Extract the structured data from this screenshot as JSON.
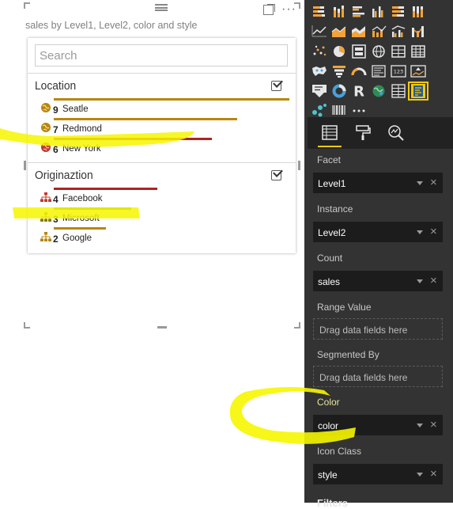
{
  "visual": {
    "title": "sales by Level1, Level2, color and style",
    "more": "···"
  },
  "facet": {
    "search_placeholder": "Search",
    "groups": [
      {
        "title": "Location",
        "items": [
          {
            "count": "9",
            "label": "Seatle",
            "bar_fraction": 1.0,
            "bar_color": "#b8860b",
            "icon": "globe-icon",
            "icon_color": "#b8860b"
          },
          {
            "count": "7",
            "label": "Redmond",
            "bar_fraction": 0.78,
            "bar_color": "#b8860b",
            "icon": "globe-icon",
            "icon_color": "#b8860b"
          },
          {
            "count": "6",
            "label": "New York",
            "bar_fraction": 0.67,
            "bar_color": "#b22222",
            "icon": "globe-icon",
            "icon_color": "#c0392b"
          }
        ]
      },
      {
        "title": "Originaztion",
        "items": [
          {
            "count": "4",
            "label": "Facebook",
            "bar_fraction": 0.44,
            "bar_color": "#b22222",
            "icon": "org-chart-icon",
            "icon_color": "#c0392b"
          },
          {
            "count": "3",
            "label": "Microsoft",
            "bar_fraction": 0.33,
            "bar_color": "#6b8e23",
            "icon": "org-chart-icon",
            "icon_color": "#8a7a10"
          },
          {
            "count": "2",
            "label": "Google",
            "bar_fraction": 0.22,
            "bar_color": "#b8860b",
            "icon": "org-chart-icon",
            "icon_color": "#b8860b"
          }
        ]
      }
    ]
  },
  "panel": {
    "wells": [
      {
        "label": "Facet",
        "value": "Level1",
        "highlight": false
      },
      {
        "label": "Instance",
        "value": "Level2",
        "highlight": false
      },
      {
        "label": "Count",
        "value": "sales",
        "highlight": false
      },
      {
        "label": "Range Value",
        "placeholder": "Drag data fields here"
      },
      {
        "label": "Segmented By",
        "placeholder": "Drag data fields here"
      },
      {
        "label": "Color",
        "value": "color",
        "highlight": true
      },
      {
        "label": "Icon Class",
        "value": "style",
        "highlight": false
      }
    ],
    "filters_label": "Filters",
    "r_icon": "R",
    "num_icon": "123"
  },
  "colors": {
    "panel_bg": "#333333",
    "accent_yellow": "#f2c811",
    "highlighter": "#ffff00"
  }
}
